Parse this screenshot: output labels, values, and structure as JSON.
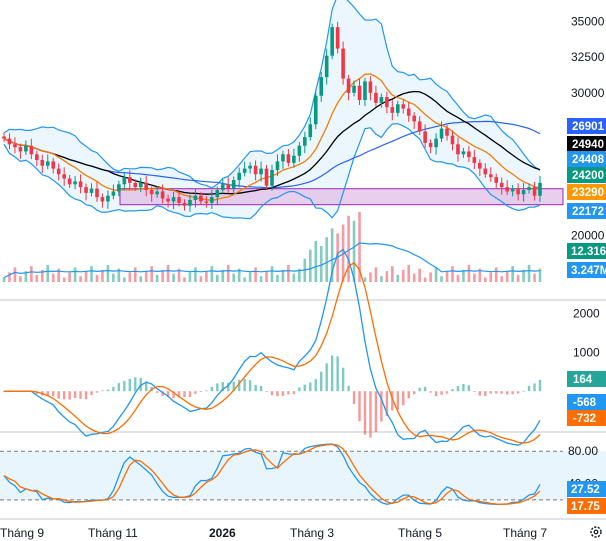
{
  "chart_data": {
    "type": "candlestick",
    "x_labels": [
      "Tháng 9",
      "Tháng 11",
      "2026",
      "Tháng 3",
      "Tháng 5",
      "Tháng 7"
    ],
    "panels": [
      {
        "id": "price",
        "ylim": [
          19000,
          36500
        ],
        "y_ticks": [
          "20000",
          "25000",
          "30000",
          "32500",
          "35000"
        ],
        "indicators": [
          "bollinger-bands",
          "sma-fast",
          "sma-slow",
          "sma-long"
        ],
        "support_zone": [
          22172,
          23290
        ],
        "candles_close": [
          26800,
          26400,
          26200,
          25900,
          26300,
          25700,
          25300,
          24900,
          25200,
          24700,
          24300,
          24000,
          23600,
          23800,
          23400,
          23000,
          23300,
          22700,
          22400,
          22800,
          23100,
          23600,
          24100,
          23700,
          23400,
          23700,
          23200,
          22900,
          23100,
          22600,
          22400,
          22700,
          22300,
          22100,
          22500,
          22800,
          22400,
          22300,
          22700,
          23200,
          23600,
          23300,
          23900,
          24400,
          24700,
          24900,
          24300,
          24700,
          23500,
          24600,
          25200,
          25700,
          25100,
          25600,
          26300,
          26900,
          27800,
          29800,
          31100,
          32600,
          34600,
          33100,
          31000,
          30000,
          30500,
          29500,
          30800,
          30000,
          29300,
          29700,
          29000,
          28600,
          29200,
          28900,
          28400,
          28000,
          27300,
          26500,
          26200,
          26800,
          27500,
          27000,
          26400,
          25700,
          25900,
          25500,
          25100,
          24700,
          24300,
          24100,
          23700,
          23400,
          23100,
          23300,
          22900,
          23200,
          23400,
          22800,
          23700
        ],
        "labels": [
          {
            "text": "26901",
            "bg": "#2962ff",
            "fg": "#ffffff",
            "value": 26901
          },
          {
            "text": "24940",
            "bg": "#000000",
            "fg": "#ffffff",
            "value": 24940
          },
          {
            "text": "24408",
            "bg": "#2196f3",
            "fg": "#ffffff",
            "value": 24408
          },
          {
            "text": "24200",
            "bg": "#089981",
            "fg": "#ffffff",
            "value": 24200
          },
          {
            "text": "23290",
            "bg": "#ff9800",
            "fg": "#ffffff",
            "value": 23290
          },
          {
            "text": "22172",
            "bg": "#2196f3",
            "fg": "#ffffff",
            "value": 22172
          }
        ]
      },
      {
        "id": "volume",
        "labels": [
          {
            "text": "12.316",
            "bg": "#089981",
            "fg": "#ffffff"
          },
          {
            "text": "3.247M",
            "bg": "#2196f3",
            "fg": "#ffffff"
          }
        ]
      },
      {
        "id": "macd",
        "ylim": [
          -1000,
          2300
        ],
        "y_ticks": [
          "1000",
          "2000"
        ],
        "labels": [
          {
            "text": "164",
            "bg": "#26a69a",
            "fg": "#ffffff",
            "value": 164
          },
          {
            "text": "-568",
            "bg": "#2196f3",
            "fg": "#ffffff",
            "value": -568
          },
          {
            "text": "-732",
            "bg": "#ff6d00",
            "fg": "#ffffff",
            "value": -732
          }
        ]
      },
      {
        "id": "stochastic",
        "ylim": [
          5,
          100
        ],
        "y_ticks": [
          "80.00",
          "40.00"
        ],
        "band": [
          20,
          80
        ],
        "labels": [
          {
            "text": "27.52",
            "bg": "#2196f3",
            "fg": "#ffffff",
            "value": 27.52
          },
          {
            "text": "17.75",
            "bg": "#ff6d00",
            "fg": "#ffffff",
            "value": 17.75
          }
        ]
      }
    ]
  },
  "colors": {
    "up": "#089981",
    "down": "#f23645",
    "bb": "#2196f3",
    "bb_fill": "#e3f2fd",
    "sma_fast": "#f57c00",
    "sma_slow": "#000000",
    "sma_long": "#2962ff",
    "zone_fill": "#e1bee7",
    "zone_border": "#9c27b0",
    "grid": "#e0e3eb"
  },
  "icons": {
    "settings": "gear-icon"
  }
}
